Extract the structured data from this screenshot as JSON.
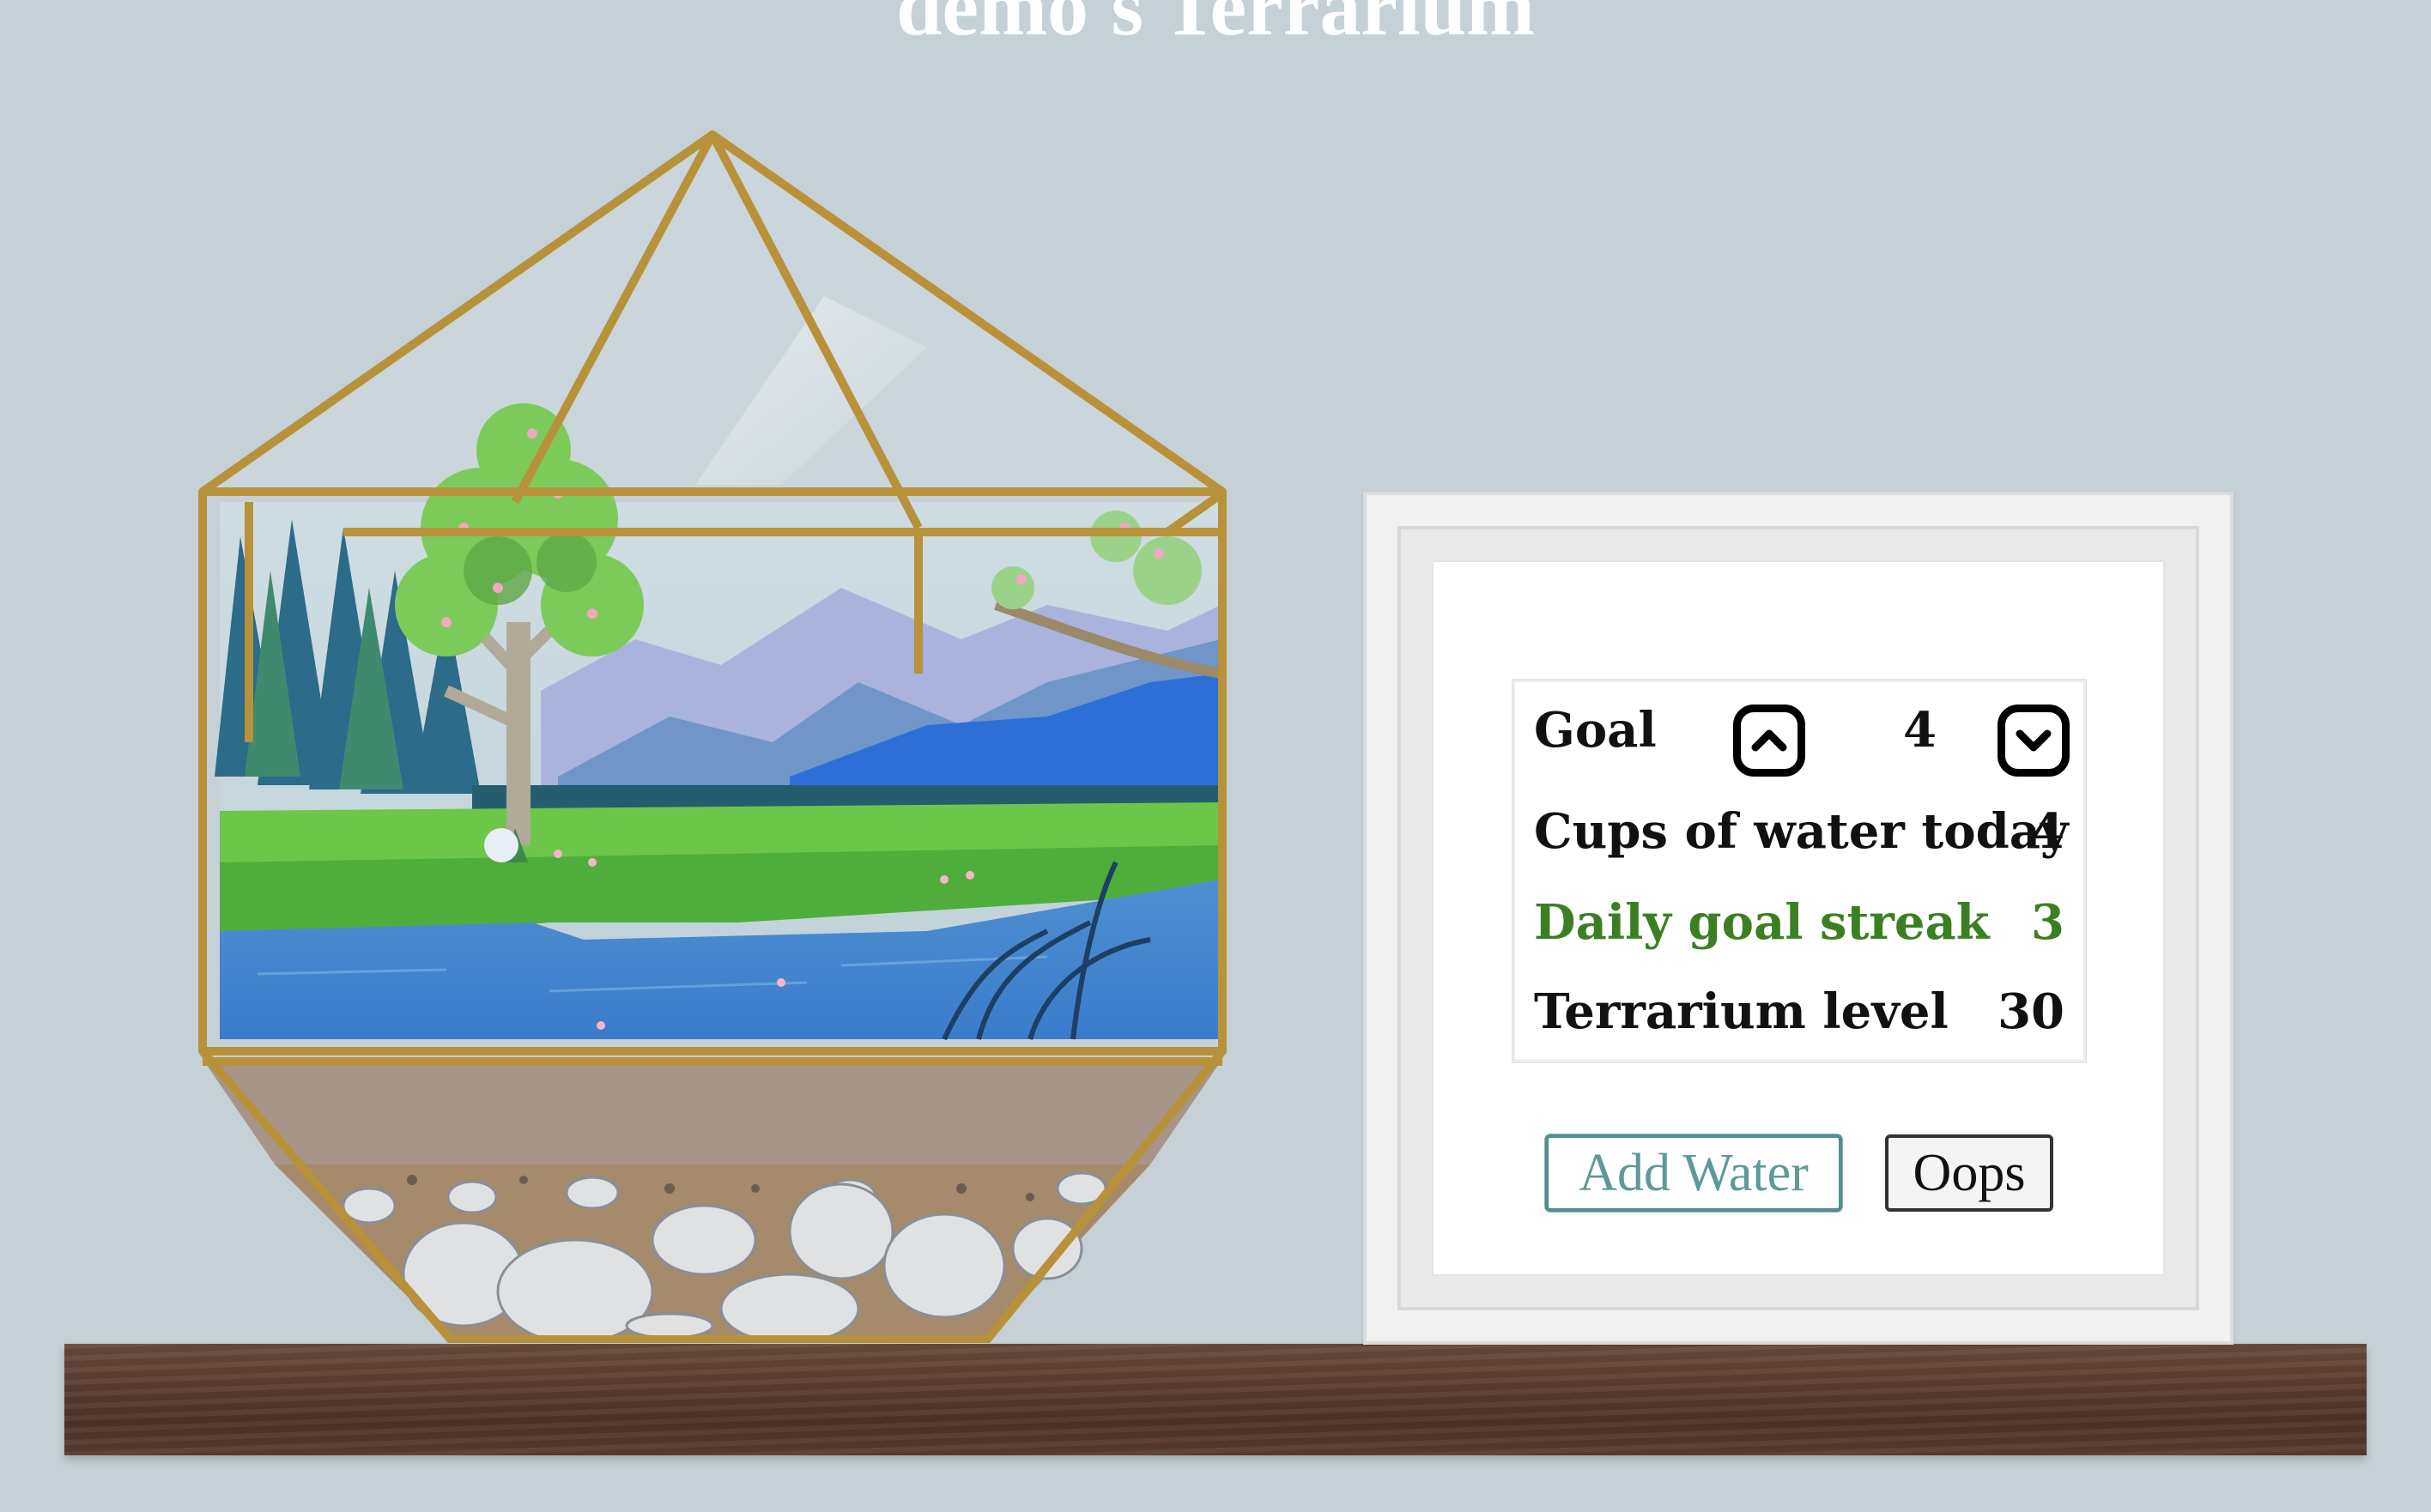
{
  "title": "demo's Terrarium",
  "stats": {
    "goal_label": "Goal",
    "goal_value": "4",
    "cups_label": "Cups of water today",
    "cups_value": "4",
    "streak_label": "Daily goal streak",
    "streak_value": "3",
    "level_label": "Terrarium level",
    "level_value": "30"
  },
  "buttons": {
    "add_water": "Add Water",
    "oops": "Oops"
  },
  "icons": {
    "goal_up": "chevron-up-icon",
    "goal_down": "chevron-down-icon"
  },
  "colors": {
    "background": "#c5d1d7",
    "streak": "#3b7f23",
    "add_water": "#5d9a99",
    "brass": "#b8923a",
    "shelf": "#5b3d31"
  }
}
